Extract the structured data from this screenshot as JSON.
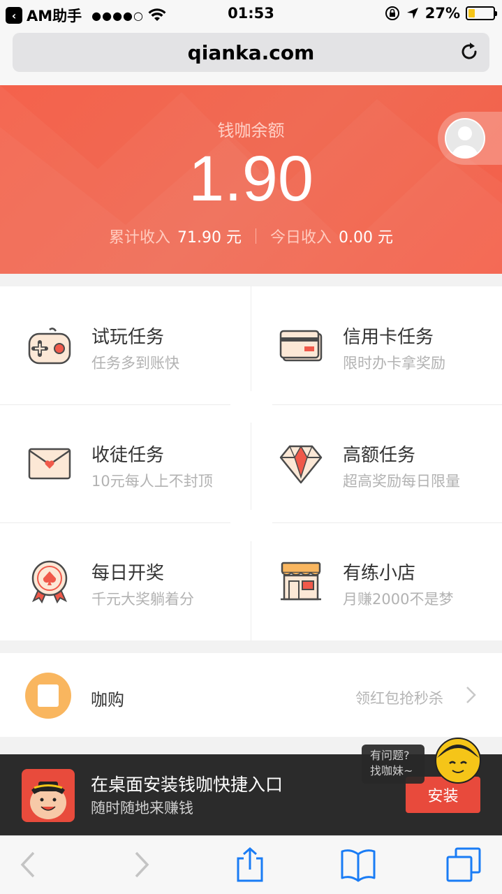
{
  "status_bar": {
    "carrier": "AM助手",
    "signal": "●●●●○",
    "time": "01:53",
    "battery": "27%",
    "battery_level": 0.27
  },
  "browser": {
    "url": "qianka.com"
  },
  "header": {
    "balance_label": "钱咖余额",
    "balance": "1.90",
    "total_income_label": "累计收入",
    "total_income": "71.90 元",
    "today_income_label": "今日收入",
    "today_income": "0.00 元"
  },
  "tasks": [
    {
      "title": "试玩任务",
      "subtitle": "任务多到账快",
      "icon": "gamepad-icon"
    },
    {
      "title": "信用卡任务",
      "subtitle": "限时办卡拿奖励",
      "icon": "credit-card-icon"
    },
    {
      "title": "收徒任务",
      "subtitle": "10元每人上不封顶",
      "icon": "envelope-icon"
    },
    {
      "title": "高额任务",
      "subtitle": "超高奖励每日限量",
      "icon": "diamond-icon"
    },
    {
      "title": "每日开奖",
      "subtitle": "千元大奖躺着分",
      "icon": "medal-icon"
    },
    {
      "title": "有练小店",
      "subtitle": "月赚2000不是梦",
      "icon": "shop-icon"
    }
  ],
  "kagou": {
    "title": "咖购",
    "promo": "领红包抢秒杀"
  },
  "help": {
    "line1": "有问题?",
    "line2": "找咖妹~"
  },
  "install_banner": {
    "title": "在桌面安装钱咖快捷入口",
    "subtitle": "随时随地来赚钱",
    "button": "安装"
  },
  "colors": {
    "accent": "#f4624c",
    "install_button": "#e84a3c",
    "toolbar_icon": "#1a7cf5"
  }
}
